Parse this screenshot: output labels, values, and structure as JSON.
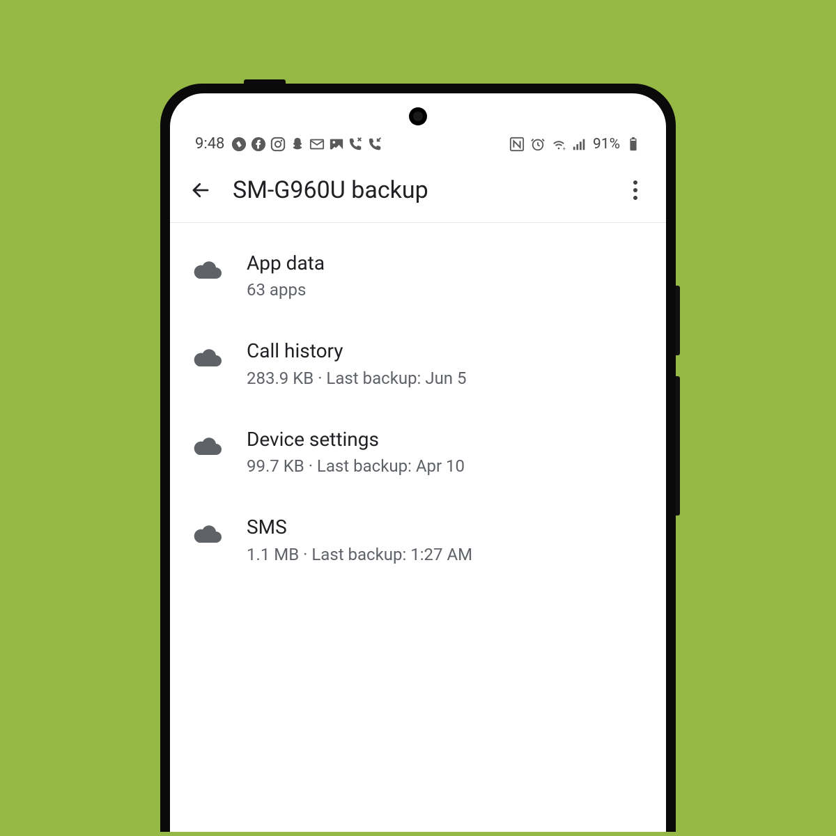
{
  "status": {
    "time": "9:48",
    "battery": "91%"
  },
  "header": {
    "title": "SM-G960U backup"
  },
  "items": [
    {
      "title": "App data",
      "subtitle": "63 apps"
    },
    {
      "title": "Call history",
      "subtitle": "283.9 KB · Last backup: Jun 5"
    },
    {
      "title": "Device settings",
      "subtitle": "99.7 KB · Last backup: Apr 10"
    },
    {
      "title": "SMS",
      "subtitle": "1.1 MB · Last backup: 1:27 AM"
    }
  ]
}
